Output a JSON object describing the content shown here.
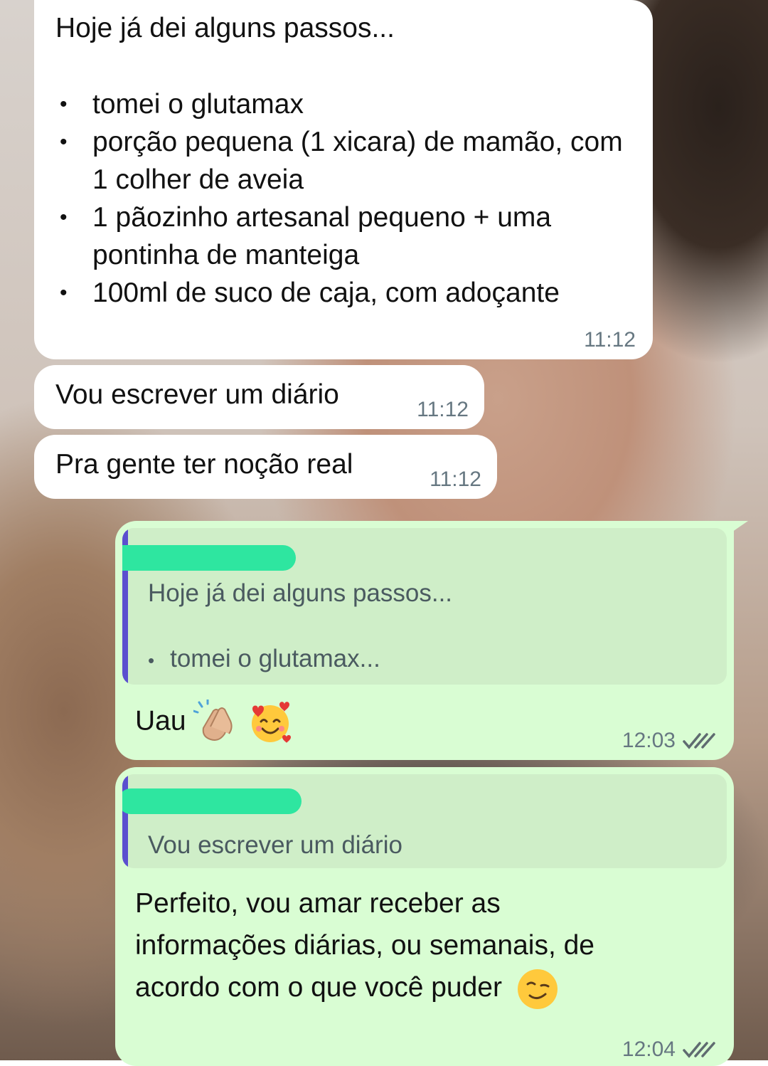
{
  "messages": [
    {
      "id": "m1",
      "direction": "incoming",
      "heading": "Hoje já dei alguns passos...",
      "items": [
        "tomei o glutamax",
        "porção pequena (1 xicara) de mamão, com 1 colher de aveia",
        "1 pãozinho artesanal pequeno + uma pontinha de manteiga",
        "100ml de suco de caja, com adoçante"
      ],
      "time": "11:12"
    },
    {
      "id": "m2",
      "direction": "incoming",
      "text": "Vou escrever um diário",
      "time": "11:12"
    },
    {
      "id": "m3",
      "direction": "incoming",
      "text": "Pra gente ter noção real",
      "time": "11:12"
    },
    {
      "id": "m4",
      "direction": "outgoing",
      "quote": {
        "line1": "Hoje já dei alguns passos...",
        "line2": "tomei o glutamax..."
      },
      "text": "Uau",
      "emojis": [
        "clapping-hands",
        "smiling-face-with-hearts"
      ],
      "time": "12:03",
      "status": "read"
    },
    {
      "id": "m5",
      "direction": "outgoing",
      "quote": {
        "line1": "Vou escrever um diário"
      },
      "text_lines": [
        "Perfeito, vou amar receber as",
        "informações diárias, ou semanais, de",
        "acordo com o que você puder"
      ],
      "emojis": [
        "winking-smile"
      ],
      "time": "12:04",
      "status": "read"
    }
  ],
  "colors": {
    "incoming_bubble": "#ffffff",
    "outgoing_bubble": "#d9fdd3",
    "quote_bar": "#5b4fcf",
    "redaction_marker": "#2ee6a0",
    "timestamp": "#667781"
  }
}
